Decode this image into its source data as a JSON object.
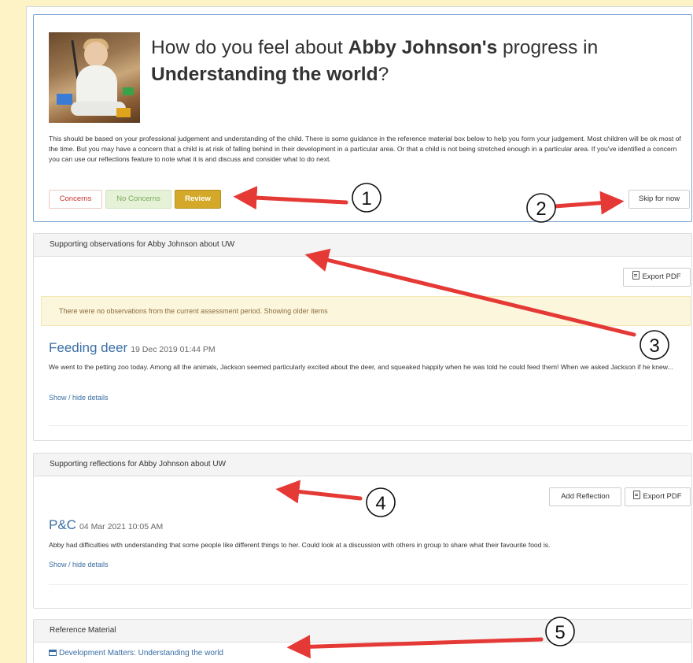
{
  "question": {
    "prefix": "How do you feel about ",
    "child_name": "Abby Johnson's",
    "middle": " progress in",
    "area": "Understanding the world",
    "suffix": "?",
    "guidance": "This should be based on your professional judgement and understanding of the child. There is some guidance in the reference material box below to help you form your judgement. Most children will be ok most of the time. But you may have a concern that a child is at risk of falling behind in their development in a particular area. Or that a child is not being stretched enough in a particular area. If you've identified a concern you can use our reflections feature to note what it is and discuss and consider what to do next.",
    "buttons": {
      "concerns": "Concerns",
      "no_concerns": "No Concerns",
      "review": "Review",
      "skip": "Skip for now"
    }
  },
  "observations": {
    "heading": "Supporting observations for Abby Johnson about UW",
    "export_label": "Export PDF",
    "notice": "There were no observations from the current assessment period. Showing older items",
    "item": {
      "title": "Feeding deer",
      "timestamp": "19 Dec 2019 01:44 PM",
      "text": "We went to the petting zoo today. Among all the animals, Jackson seemed particularly excited about the deer, and squeaked happily when he was told he could feed them! When we asked Jackson if he knew...",
      "toggle": "Show / hide details"
    }
  },
  "reflections": {
    "heading": "Supporting reflections for Abby Johnson about UW",
    "add_label": "Add Reflection",
    "export_label": "Export PDF",
    "item": {
      "title": "P&C",
      "timestamp": "04 Mar 2021 10:05 AM",
      "text": "Abby had difficulties with understanding that some people like different things to her. Could look at a discussion with others in group to share what their favourite food is.",
      "toggle": "Show / hide details"
    }
  },
  "reference": {
    "heading": "Reference Material",
    "link": "Development Matters: Understanding the world"
  },
  "annotations": {
    "n1": "1",
    "n2": "2",
    "n3": "3",
    "n4": "4",
    "n5": "5",
    "arrow_color": "#e53935"
  },
  "colors": {
    "page_bg": "#fdf3c6",
    "link": "#3a6ea5",
    "review": "#d4a92a",
    "card_border": "#7fa7d6"
  }
}
